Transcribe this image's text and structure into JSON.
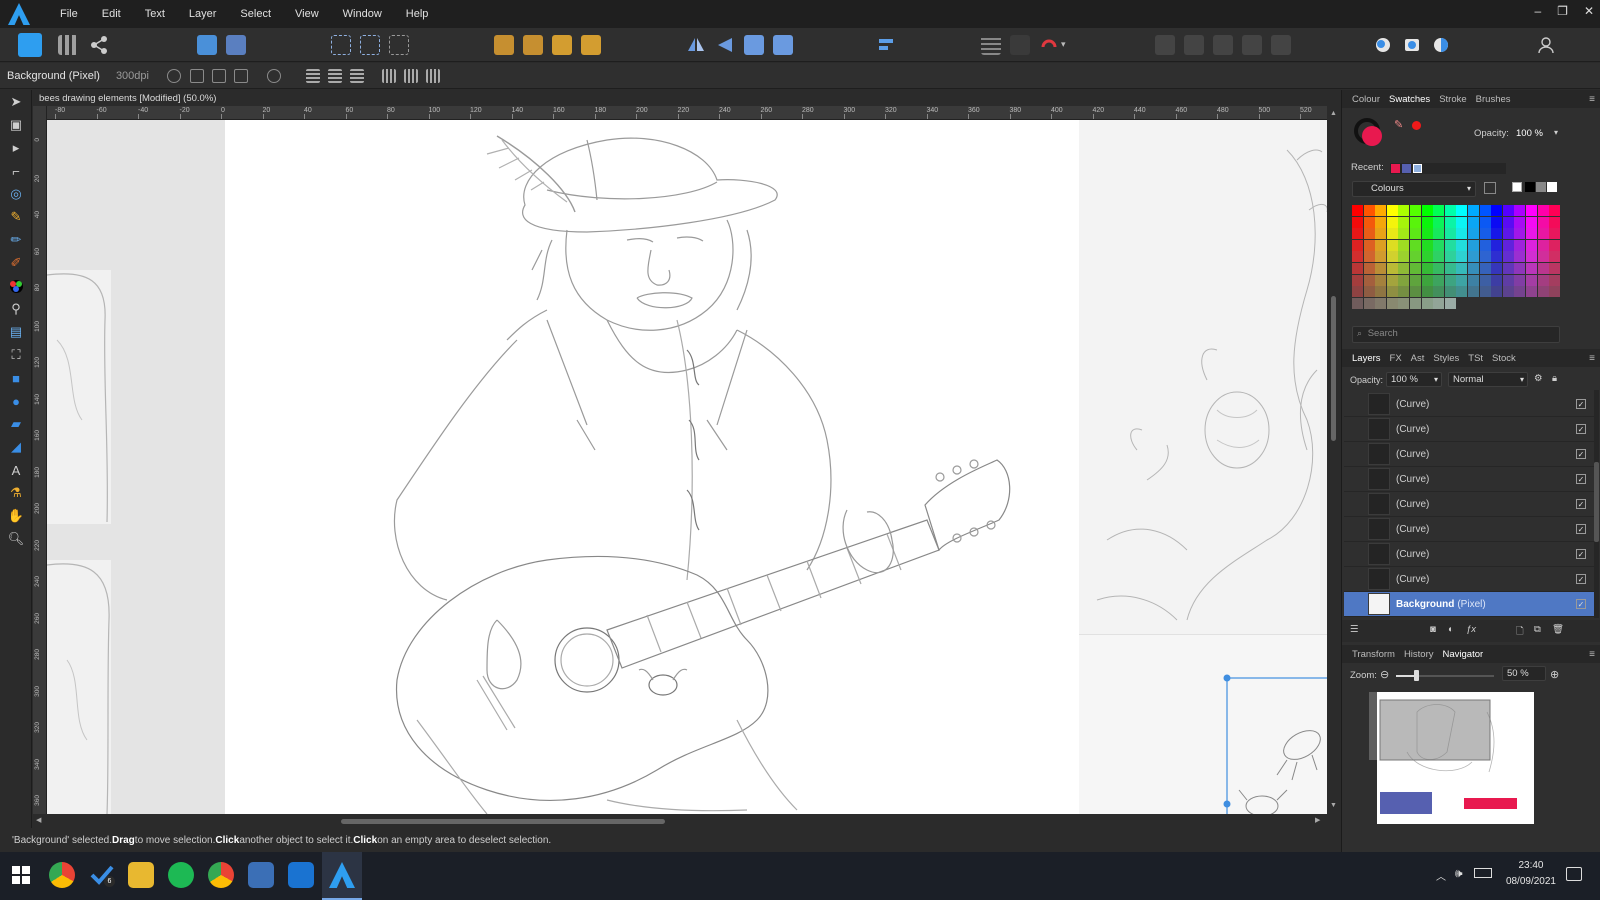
{
  "menubar": {
    "items": [
      "File",
      "Edit",
      "Text",
      "Layer",
      "Select",
      "View",
      "Window",
      "Help"
    ],
    "window_controls": [
      "–",
      "❐",
      "✕"
    ]
  },
  "context": {
    "layer_name": "Background (Pixel)",
    "dpi": "300dpi"
  },
  "document": {
    "tab_title": "bees drawing elements [Modified] (50.0%)",
    "close": "✕",
    "ruler_unit": "mm",
    "hruler_ticks": [
      "-80",
      "-60",
      "-40",
      "-20",
      "0",
      "20",
      "40",
      "60",
      "80",
      "100",
      "120",
      "140",
      "160",
      "180",
      "200",
      "220",
      "240",
      "260",
      "280",
      "300",
      "320",
      "340",
      "360",
      "380",
      "400",
      "420",
      "440",
      "460",
      "480",
      "500",
      "520"
    ],
    "vruler_ticks": [
      "0",
      "20",
      "40",
      "60",
      "80",
      "100",
      "120",
      "140",
      "160",
      "180",
      "200",
      "220",
      "240",
      "260",
      "280",
      "300",
      "320",
      "340",
      "360"
    ]
  },
  "statusbar": {
    "part1": "'Background' selected. ",
    "b1": "Drag",
    "part2": " to move selection. ",
    "b2": "Click",
    "part3": " another object to select it. ",
    "b3": "Click",
    "part4": " on an empty area to deselect selection."
  },
  "colour_panel": {
    "tabs": [
      "Colour",
      "Swatches",
      "Stroke",
      "Brushes"
    ],
    "active_tab": "Swatches",
    "opacity_label": "Opacity:",
    "opacity_value": "100 %",
    "recent_label": "Recent:",
    "palette_name": "Colours",
    "search_placeholder": "Search",
    "fill_color": "#e8194f",
    "stroke_color": "#111111",
    "recent_colors": [
      "#e8194f",
      "#5660b0",
      "#8fb0e0"
    ]
  },
  "layers_panel": {
    "tabs": [
      "Layers",
      "FX",
      "Ast",
      "Styles",
      "TSt",
      "Stock"
    ],
    "active_tab": "Layers",
    "opacity_label": "Opacity:",
    "opacity_value": "100 %",
    "blend_mode": "Normal",
    "layers": [
      "(Curve)",
      "(Curve)",
      "(Curve)",
      "(Curve)",
      "(Curve)",
      "(Curve)",
      "(Curve)",
      "(Curve)"
    ],
    "selected_layer_name": "Background",
    "selected_layer_type": "(Pixel)"
  },
  "navigator_panel": {
    "tabs": [
      "Transform",
      "History",
      "Navigator"
    ],
    "active_tab": "Navigator",
    "zoom_label": "Zoom:",
    "zoom_value": "50 %",
    "zoom_level": 0.5
  },
  "taskbar": {
    "time": "23:40",
    "date": "08/09/2021",
    "badge": "6"
  },
  "colors": {
    "accent": "#4f78c4",
    "selection": "#3f8ee0"
  }
}
